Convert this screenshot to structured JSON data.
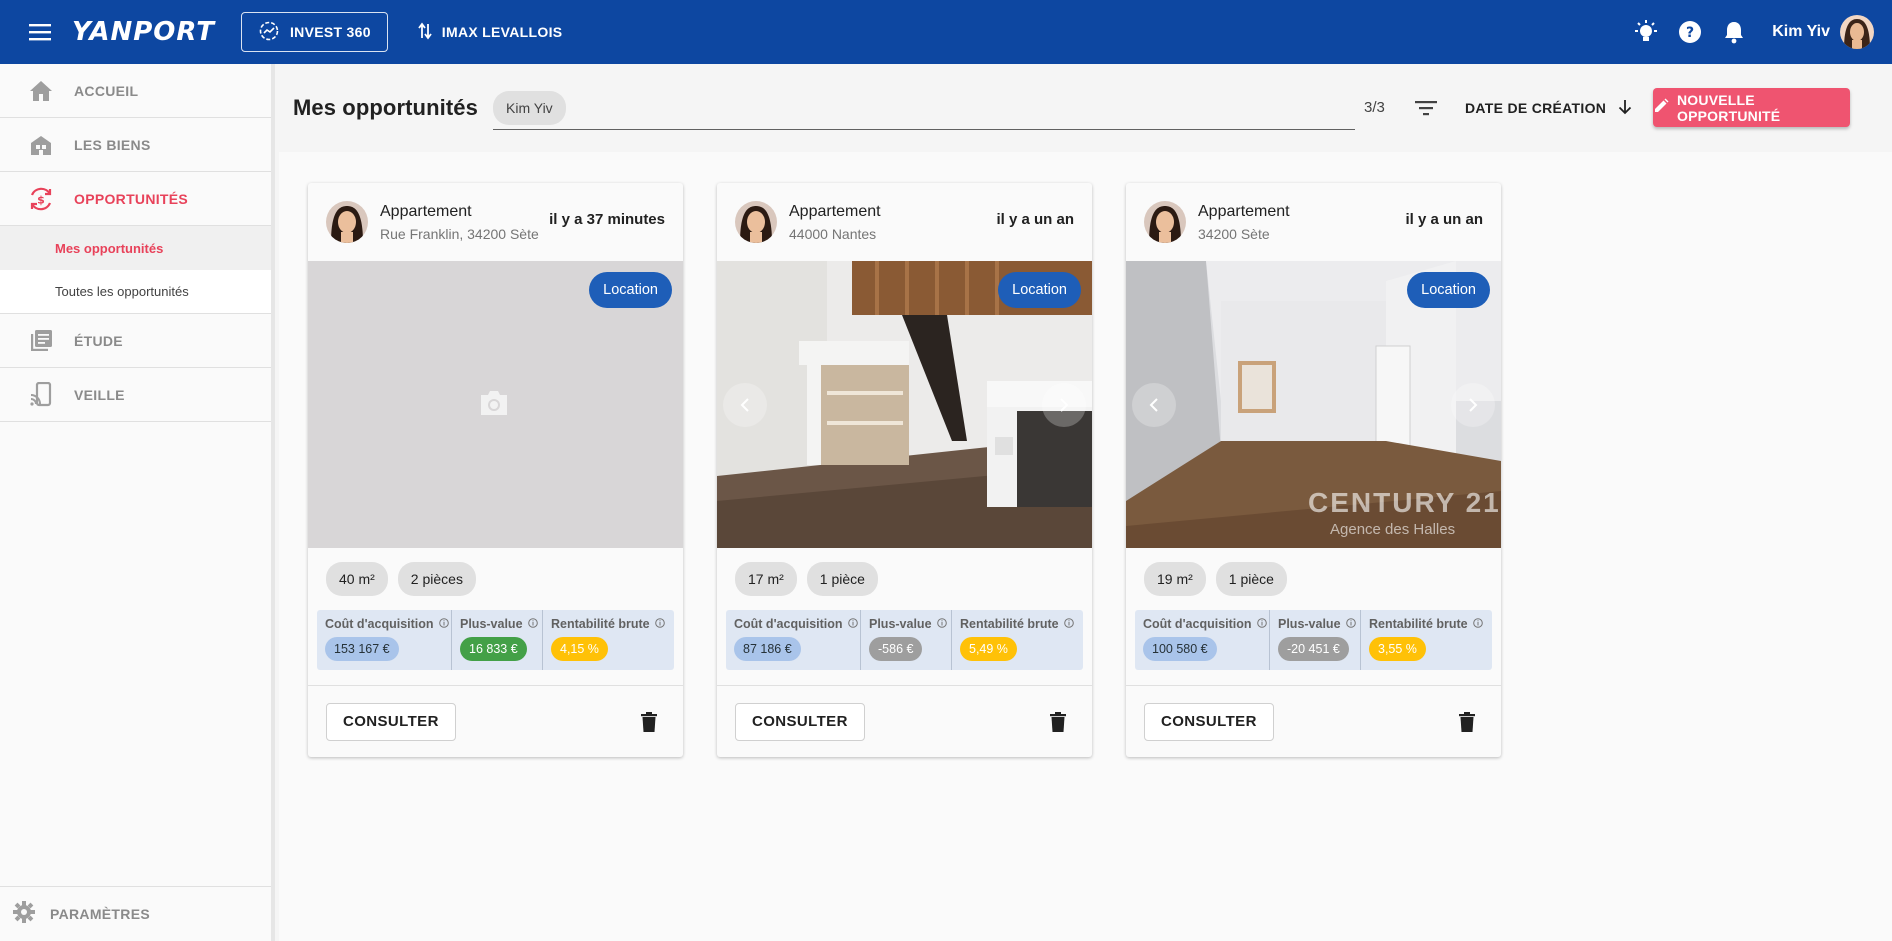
{
  "topbar": {
    "brand": "YANPORT",
    "invest_label": "INVEST 360",
    "portfolio_label": "IMAX LEVALLOIS",
    "user_name": "Kim Yiv"
  },
  "sidebar": {
    "items": [
      {
        "label": "ACCUEIL"
      },
      {
        "label": "LES BIENS"
      },
      {
        "label": "OPPORTUNITÉS"
      },
      {
        "label": "ÉTUDE"
      },
      {
        "label": "VEILLE"
      }
    ],
    "subitems": [
      {
        "label": "Mes opportunités"
      },
      {
        "label": "Toutes les opportunités"
      }
    ],
    "settings_label": "PARAMÈTRES"
  },
  "toolbar": {
    "title": "Mes opportunités",
    "filter_chip": "Kim Yiv",
    "count": "3/3",
    "sort_label": "DATE DE CRÉATION",
    "new_label": "NOUVELLE OPPORTUNITÉ"
  },
  "labels": {
    "acquisition": "Coût d'acquisition",
    "plus_value": "Plus-value",
    "rentabilite": "Rentabilité brute",
    "consult": "CONSULTER"
  },
  "cards": [
    {
      "type": "Appartement",
      "address": "Rue Franklin, 34200 Sète",
      "time": "il y a 37 minutes",
      "badge": "Location",
      "surface": "40 m²",
      "rooms": "2 pièces",
      "acquisition": "153 167 €",
      "plus_value": "16 833 €",
      "rentabilite": "4,15 %"
    },
    {
      "type": "Appartement",
      "address": "44000 Nantes",
      "time": "il y a un an",
      "badge": "Location",
      "surface": "17 m²",
      "rooms": "1 pièce",
      "acquisition": "87 186 €",
      "plus_value": "-586 €",
      "rentabilite": "5,49 %"
    },
    {
      "type": "Appartement",
      "address": "34200 Sète",
      "time": "il y a un an",
      "badge": "Location",
      "surface": "19 m²",
      "rooms": "1 pièce",
      "acquisition": "100 580 €",
      "plus_value": "-20 451 €",
      "rentabilite": "3,55 %",
      "watermark_brand": "CENTURY 21",
      "watermark_agency": "Agence des Halles"
    }
  ],
  "colors": {
    "topbar": "#0d47a1",
    "accent": "#e8425a",
    "badge": "#1e5eb8"
  }
}
